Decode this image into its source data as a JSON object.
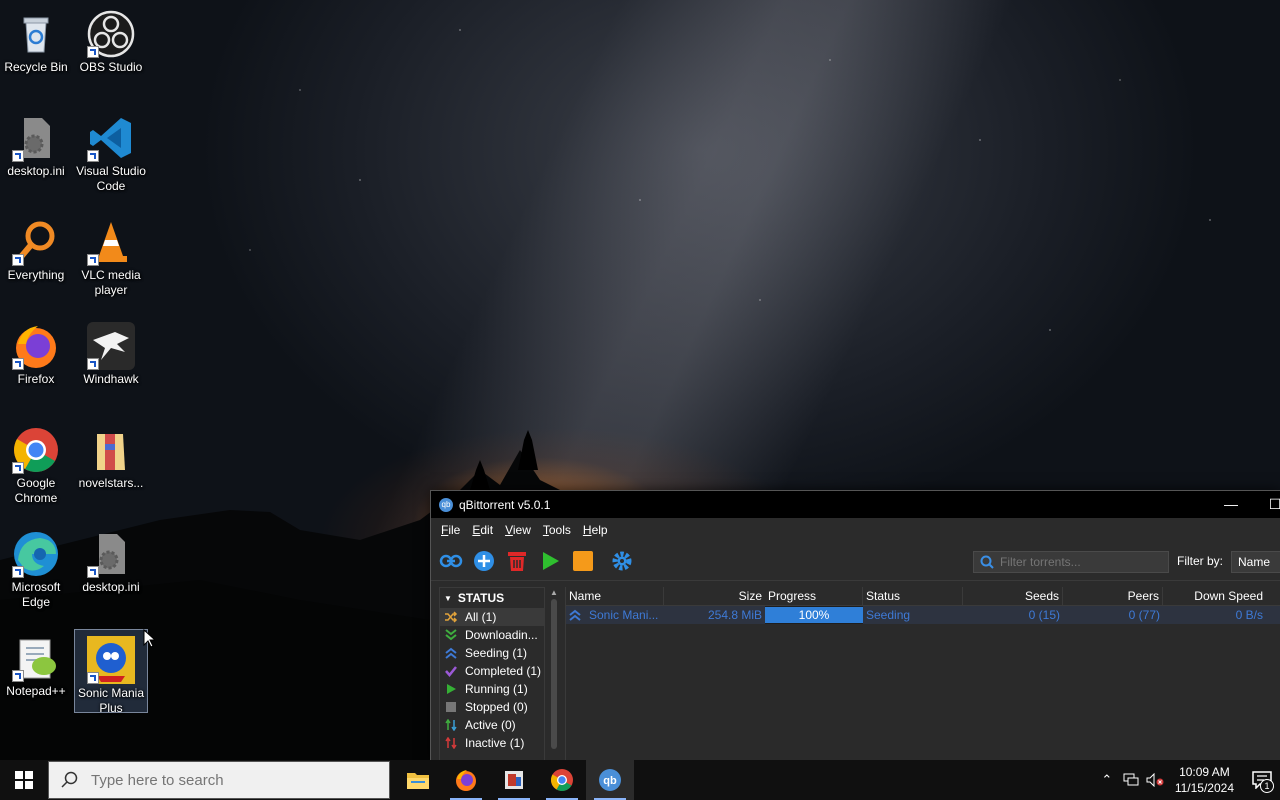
{
  "desktop": {
    "icons": [
      {
        "label": "Recycle Bin"
      },
      {
        "label": "OBS Studio"
      },
      {
        "label": "desktop.ini"
      },
      {
        "label": "Visual Studio Code"
      },
      {
        "label": "Everything"
      },
      {
        "label": "VLC media player"
      },
      {
        "label": "Firefox"
      },
      {
        "label": "Windhawk"
      },
      {
        "label": "Google Chrome"
      },
      {
        "label": "novelstars..."
      },
      {
        "label": "Microsoft Edge"
      },
      {
        "label": "desktop.ini"
      },
      {
        "label": "Notepad++"
      },
      {
        "label": "Sonic Mania Plus"
      }
    ]
  },
  "qbittorrent": {
    "title": "qBittorrent v5.0.1",
    "menu": [
      "File",
      "Edit",
      "View",
      "Tools",
      "Help"
    ],
    "filter_placeholder": "Filter torrents...",
    "filter_by_label": "Filter by:",
    "filter_by_value": "Name",
    "sidebar": {
      "header": "STATUS",
      "items": [
        {
          "label": "All (1)",
          "icon": "shuffle-icon",
          "color": "#e2a33a"
        },
        {
          "label": "Downloadin...",
          "icon": "download-icon",
          "color": "#3fae3f"
        },
        {
          "label": "Seeding (1)",
          "icon": "upload-icon",
          "color": "#3e7ad6"
        },
        {
          "label": "Completed (1)",
          "icon": "check-icon",
          "color": "#9b59d6"
        },
        {
          "label": "Running (1)",
          "icon": "play-icon",
          "color": "#35b035"
        },
        {
          "label": "Stopped (0)",
          "icon": "stop-icon",
          "color": "#777777"
        },
        {
          "label": "Active (0)",
          "icon": "arrows-icon",
          "color": "#3a9fd6"
        },
        {
          "label": "Inactive (1)",
          "icon": "inactive-icon",
          "color": "#d43a3a"
        }
      ]
    },
    "columns": [
      "Name",
      "Size",
      "Progress",
      "Status",
      "Seeds",
      "Peers",
      "Down Speed"
    ],
    "rows": [
      {
        "name": "Sonic Mani...",
        "size": "254.8 MiB",
        "progress": 100,
        "progress_label": "100%",
        "status": "Seeding",
        "seeds": "0 (15)",
        "peers": "0 (77)",
        "down_speed": "0 B/s"
      }
    ]
  },
  "taskbar": {
    "search_placeholder": "Type here to search",
    "apps": [
      "file-explorer-icon",
      "firefox-icon",
      "media-app-icon",
      "chrome-icon",
      "qbittorrent-icon"
    ],
    "time": "10:09 AM",
    "date": "11/15/2024",
    "notification_count": "1"
  },
  "colors": {
    "accent_blue": "#2f7fd8",
    "seeding_text": "#3e7ad6",
    "window_bg": "#2b2b2b"
  }
}
